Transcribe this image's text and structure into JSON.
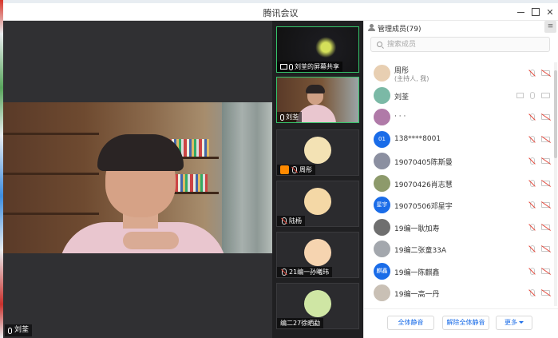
{
  "window": {
    "title": "腾讯会议"
  },
  "main_video": {
    "speaker_name": "刘荃"
  },
  "thumbnails": [
    {
      "label": "刘荃的屏幕共享",
      "kind": "share"
    },
    {
      "label": "刘荃",
      "kind": "video"
    },
    {
      "label": "周彤",
      "kind": "avatar",
      "avatar_color": "#f3e2b4",
      "host": true
    },
    {
      "label": "陆杨",
      "kind": "avatar",
      "avatar_color": "#f4d8a6"
    },
    {
      "label": "21编一孙曦玮",
      "kind": "avatar",
      "avatar_color": "#f6d4b0"
    },
    {
      "label": "编二27徐晒勐",
      "kind": "avatar",
      "avatar_color": "#cfe6a4"
    }
  ],
  "panel": {
    "header_title": "管理成员(79)",
    "collapse_label": "≡",
    "search_placeholder": "搜索成员"
  },
  "members": [
    {
      "name": "周彤",
      "sub": "(主持人, 我)",
      "avatar_text": "",
      "avatar_color": "#e8cfb2",
      "mic_off": true,
      "cam_off": true,
      "sharing": false
    },
    {
      "name": "刘荃",
      "sub": "",
      "avatar_text": "",
      "avatar_color": "#7bb9a6",
      "mic_off": false,
      "cam_off": false,
      "sharing": true
    },
    {
      "name": "· · ·",
      "sub": "",
      "avatar_text": "",
      "avatar_color": "#b07aa8",
      "mic_off": true,
      "cam_off": true,
      "sharing": false
    },
    {
      "name": "138****8001",
      "sub": "",
      "avatar_text": "01",
      "avatar_color": "#1a6ce8",
      "mic_off": true,
      "cam_off": true,
      "sharing": false
    },
    {
      "name": "19070405陈斯曼",
      "sub": "",
      "avatar_text": "",
      "avatar_color": "#8b8fa0",
      "mic_off": true,
      "cam_off": true,
      "sharing": false
    },
    {
      "name": "19070426肖志慧",
      "sub": "",
      "avatar_text": "",
      "avatar_color": "#8d9a6b",
      "mic_off": true,
      "cam_off": true,
      "sharing": false
    },
    {
      "name": "19070506邓星宇",
      "sub": "",
      "avatar_text": "星宇",
      "avatar_color": "#1a6ce8",
      "mic_off": true,
      "cam_off": true,
      "sharing": false
    },
    {
      "name": "19编一耿加寿",
      "sub": "",
      "avatar_text": "",
      "avatar_color": "#6f6f6f",
      "mic_off": true,
      "cam_off": true,
      "sharing": false
    },
    {
      "name": "19编二张童33A",
      "sub": "",
      "avatar_text": "",
      "avatar_color": "#a3a7ad",
      "mic_off": true,
      "cam_off": true,
      "sharing": false
    },
    {
      "name": "19编一陈麒鑫",
      "sub": "",
      "avatar_text": "麒鑫",
      "avatar_color": "#1a6ce8",
      "mic_off": true,
      "cam_off": true,
      "sharing": false
    },
    {
      "name": "19编一高一丹",
      "sub": "",
      "avatar_text": "",
      "avatar_color": "#c9c0b5",
      "mic_off": true,
      "cam_off": true,
      "sharing": false
    }
  ],
  "footer": {
    "mute_all": "全体静音",
    "unmute_all": "解除全体静音",
    "more": "更多"
  }
}
